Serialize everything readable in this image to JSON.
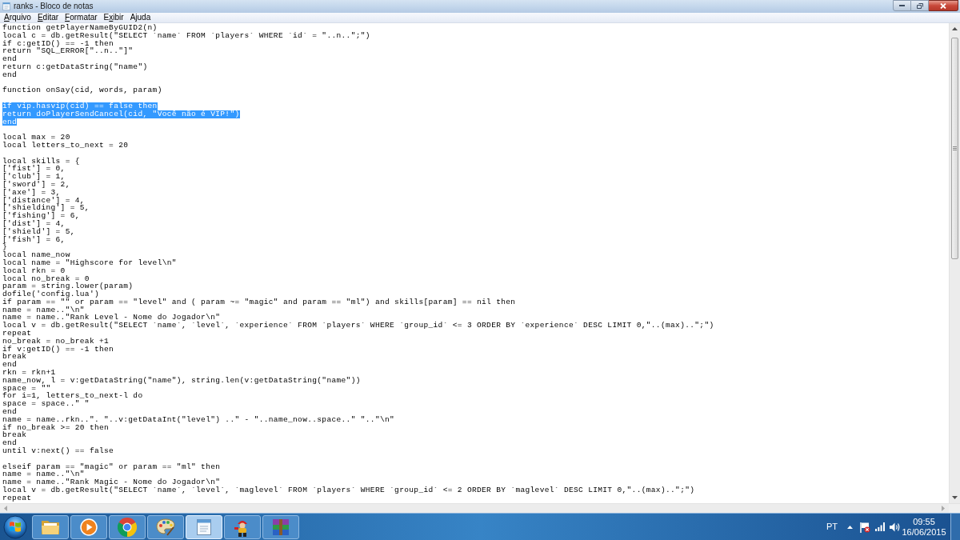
{
  "window": {
    "title": "ranks - Bloco de notas"
  },
  "menu": [
    {
      "access_key": "A",
      "label_after": "rquivo"
    },
    {
      "access_key": "E",
      "label_after": "ditar"
    },
    {
      "access_key": "F",
      "label_after": "ormatar"
    },
    {
      "label_before": "E",
      "access_key": "x",
      "label_after": "ibir"
    },
    {
      "label_before": "A",
      "access_key": "j",
      "label_after": "uda"
    }
  ],
  "editor": {
    "blocks": [
      {
        "lines": [
          {
            "text": "function getPlayerNameByGUID2(n)",
            "selected": false
          },
          {
            "text": "local c = db.getResult(\"SELECT `name` FROM `players` WHERE `id` = \"..n..\";\")",
            "selected": false
          },
          {
            "text": "if c:getID() == -1 then",
            "selected": false
          },
          {
            "text": "return \"SQL_ERROR[\"..n..\"]\"",
            "selected": false
          },
          {
            "text": "end",
            "selected": false
          },
          {
            "text": "return c:getDataString(\"name\")",
            "selected": false
          },
          {
            "text": "end",
            "selected": false
          }
        ]
      },
      {
        "lines": [
          {
            "text": "function onSay(cid, words, param)",
            "selected": false
          }
        ]
      },
      {
        "lines": [
          {
            "text": "if vip.hasvip(cid) == false then",
            "selected": true
          },
          {
            "text": "return doPlayerSendCancel(cid, \"Você não é VIP!\")",
            "selected": true
          },
          {
            "text": "end",
            "selected": true
          }
        ]
      },
      {
        "lines": [
          {
            "text": "local max = 20",
            "selected": false
          },
          {
            "text": "local letters_to_next = 20",
            "selected": false
          }
        ]
      },
      {
        "lines": [
          {
            "text": "local skills = {",
            "selected": false
          },
          {
            "text": "['fist'] = 0,",
            "selected": false
          },
          {
            "text": "['club'] = 1,",
            "selected": false
          },
          {
            "text": "['sword'] = 2,",
            "selected": false
          },
          {
            "text": "['axe'] = 3,",
            "selected": false
          },
          {
            "text": "['distance'] = 4,",
            "selected": false
          },
          {
            "text": "['shielding'] = 5,",
            "selected": false
          },
          {
            "text": "['fishing'] = 6,",
            "selected": false
          },
          {
            "text": "['dist'] = 4,",
            "selected": false
          },
          {
            "text": "['shield'] = 5,",
            "selected": false
          },
          {
            "text": "['fish'] = 6,",
            "selected": false
          },
          {
            "text": "}",
            "selected": false
          },
          {
            "text": "local name_now",
            "selected": false
          },
          {
            "text": "local name = \"Highscore for level\\n\"",
            "selected": false
          },
          {
            "text": "local rkn = 0",
            "selected": false
          },
          {
            "text": "local no_break = 0",
            "selected": false
          },
          {
            "text": "param = string.lower(param)",
            "selected": false
          },
          {
            "text": "dofile('config.lua')",
            "selected": false
          },
          {
            "text": "if param == \"\" or param == \"level\" and ( param ~= \"magic\" and param == \"ml\") and skills[param] == nil then",
            "selected": false
          },
          {
            "text": "name = name..\"\\n\"",
            "selected": false
          },
          {
            "text": "name = name..\"Rank Level - Nome do Jogador\\n\"",
            "selected": false
          },
          {
            "text": "local v = db.getResult(\"SELECT `name`, `level`, `experience` FROM `players` WHERE `group_id` <= 3 ORDER BY `experience` DESC LIMIT 0,\"..(max)..\";\")",
            "selected": false
          },
          {
            "text": "repeat",
            "selected": false
          },
          {
            "text": "no_break = no_break +1",
            "selected": false
          },
          {
            "text": "if v:getID() == -1 then",
            "selected": false
          },
          {
            "text": "break",
            "selected": false
          },
          {
            "text": "end",
            "selected": false
          },
          {
            "text": "rkn = rkn+1",
            "selected": false
          },
          {
            "text": "name_now, l = v:getDataString(\"name\"), string.len(v:getDataString(\"name\"))",
            "selected": false
          },
          {
            "text": "space = \"\"",
            "selected": false
          },
          {
            "text": "for i=1, letters_to_next-l do",
            "selected": false
          },
          {
            "text": "space = space..\" \"",
            "selected": false
          },
          {
            "text": "end",
            "selected": false
          },
          {
            "text": "name = name..rkn..\". \"..v:getDataInt(\"level\") ..\" - \"..name_now..space..\" \"..\"\\n\"",
            "selected": false
          },
          {
            "text": "if no_break >= 20 then",
            "selected": false
          },
          {
            "text": "break",
            "selected": false
          },
          {
            "text": "end",
            "selected": false
          },
          {
            "text": "until v:next() == false",
            "selected": false
          }
        ]
      },
      {
        "lines": [
          {
            "text": "elseif param == \"magic\" or param == \"ml\" then",
            "selected": false
          },
          {
            "text": "name = name..\"\\n\"",
            "selected": false
          },
          {
            "text": "name = name..\"Rank Magic - Nome do Jogador\\n\"",
            "selected": false
          },
          {
            "text": "local v = db.getResult(\"SELECT `name`, `level`, `maglevel` FROM `players` WHERE `group_id` <= 2 ORDER BY `maglevel` DESC LIMIT 0,\"..(max)..\";\")",
            "selected": false
          },
          {
            "text": "repeat",
            "selected": false
          }
        ]
      }
    ]
  },
  "taskbar": {
    "apps": [
      {
        "kind": "folder",
        "selected": false
      },
      {
        "kind": "player",
        "selected": false
      },
      {
        "kind": "browser",
        "selected": false
      },
      {
        "kind": "palette",
        "selected": false
      },
      {
        "kind": "notepad",
        "selected": true
      },
      {
        "kind": "character",
        "selected": false
      },
      {
        "kind": "books",
        "selected": false
      }
    ],
    "tray": {
      "language": "PT",
      "time": "09:55",
      "date": "16/06/2015"
    }
  }
}
